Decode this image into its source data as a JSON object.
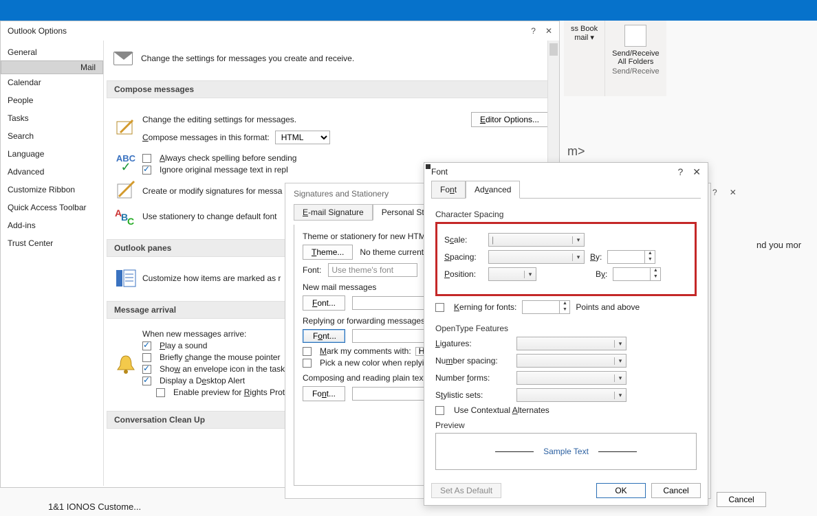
{
  "ribbon": {
    "addrbook_line1": "ss Book",
    "addrbook_line2": "mail ▾",
    "sendrecv1": "Send/Receive",
    "sendrecv2": "All Folders",
    "sendrecv_section": "Send/Receive"
  },
  "bg_address": "m>",
  "outlook_options": {
    "title": "Outlook Options",
    "sidebar": [
      "General",
      "Mail",
      "Calendar",
      "People",
      "Tasks",
      "Search",
      "Language",
      "Advanced",
      "Customize Ribbon",
      "Quick Access Toolbar",
      "Add-ins",
      "Trust Center"
    ],
    "intro": "Change the settings for messages you create and receive.",
    "compose": {
      "header": "Compose messages",
      "editing": "Change the editing settings for messages.",
      "editor_btn": "Editor Options...",
      "format_label": "Compose messages in this format:",
      "format_value": "HTML",
      "always_spell": "Always check spelling before sending",
      "ignore_orig": "Ignore original message text in repl",
      "sig_intro": "Create or modify signatures for messa",
      "stationery": "Use stationery to change default font"
    },
    "panes": {
      "header": "Outlook panes",
      "desc": "Customize how items are marked as r"
    },
    "arrival": {
      "header": "Message arrival",
      "intro": "When new messages arrive:",
      "play": "Play a sound",
      "mouse": "Briefly change the mouse pointer",
      "envelope": "Show an envelope icon in the task",
      "desktop": "Display a Desktop Alert",
      "preview": "Enable preview for Rights Prote"
    },
    "cleanup_header": "Conversation Clean Up"
  },
  "sig": {
    "title": "Signatures and Stationery",
    "tab1": "E-mail Signature",
    "tab2": "Personal Station",
    "theme_lbl": "Theme or stationery for new HTML e",
    "theme_btn": "Theme...",
    "no_theme": "No theme currentl",
    "font_lbl": "Font:",
    "font_val": "Use theme's font",
    "new_mail": "New mail messages",
    "font_btn": "Font...",
    "reply": "Replying or forwarding messages",
    "mark": "Mark my comments with:",
    "mark_val": "Huy",
    "pickcolor": "Pick a new color when replying",
    "plain": "Composing and reading plain text m"
  },
  "font": {
    "title": "Font",
    "tab_font": "Font",
    "tab_adv": "Advanced",
    "charspacing": "Character Spacing",
    "scale": "Scale:",
    "spacing": "Spacing:",
    "position": "Position:",
    "by": "By:",
    "kerning": "Kerning for fonts:",
    "points": "Points and above",
    "opentype": "OpenType Features",
    "ligatures": "Ligatures:",
    "numspacing": "Number spacing:",
    "numforms": "Number forms:",
    "stylistic": "Stylistic sets:",
    "contextual": "Use Contextual Alternates",
    "preview": "Preview",
    "sample": "Sample Text",
    "setdefault": "Set As Default",
    "ok": "OK",
    "cancel": "Cancel"
  },
  "footer": {
    "cancel2": "Cancel",
    "peek": "nd you mor",
    "ionos": "1&1 IONOS Custome..."
  }
}
